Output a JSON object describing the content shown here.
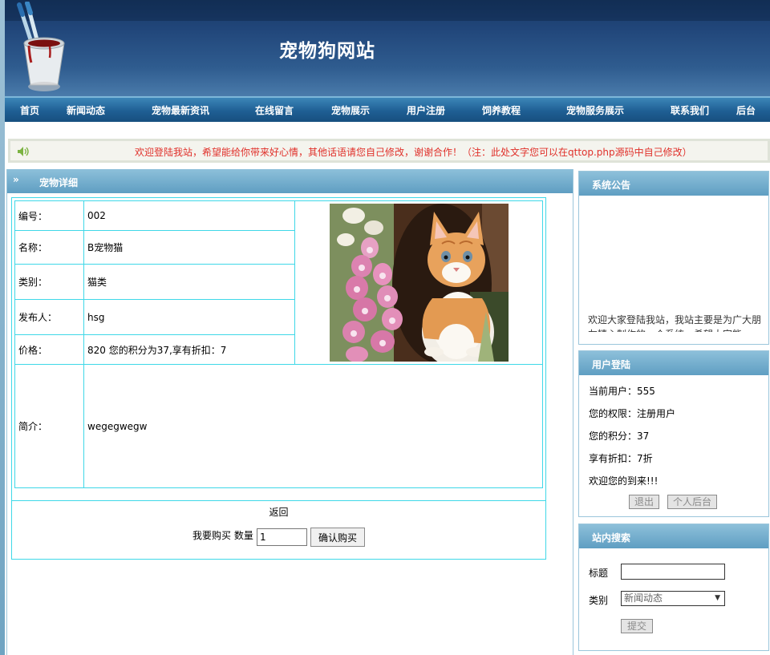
{
  "site": {
    "title": "宠物狗网站"
  },
  "nav": [
    "首页",
    "新闻动态",
    "宠物最新资讯",
    "在线留言",
    "宠物展示",
    "用户注册",
    "饲养教程",
    "宠物服务展示",
    "联系我们",
    "后台"
  ],
  "marquee": "欢迎登陆我站，希望能给你带来好心情，其他话语请您自己修改，谢谢合作！（注：此处文字您可以在qttop.php源码中自己修改）",
  "main": {
    "title": "宠物详细",
    "rows": [
      {
        "label": "编号：",
        "value": "002"
      },
      {
        "label": "名称：",
        "value": "B宠物猫"
      },
      {
        "label": "类别：",
        "value": "猫类"
      },
      {
        "label": "发布人：",
        "value": "hsg"
      },
      {
        "label": "价格：",
        "value": "820 您的积分为37,享有折扣：7"
      },
      {
        "label": "简介：",
        "value": "wegegwegw"
      }
    ],
    "back_label": "返回",
    "buy_label": "我要购买 数量",
    "quantity": "1",
    "buy_button": "确认购买"
  },
  "notice": {
    "title": "系统公告",
    "text": "欢迎大家登陆我站，我站主要是为广大朋友精心制作的一个系统，希望大家能"
  },
  "login": {
    "title": "用户登陆",
    "lines": [
      "当前用户：555",
      "您的权限：注册用户",
      "您的积分：37",
      "享有折扣：7折",
      "欢迎您的到来!!!"
    ],
    "logout": "退出",
    "backend": "个人后台"
  },
  "search": {
    "title": "站内搜索",
    "title_label": "标题",
    "category_label": "类别",
    "category_selected": "新闻动态",
    "submit": "提交"
  },
  "colors": {
    "header": "#21467a",
    "nav": "#1f5f94",
    "marquee_text": "#e0302a",
    "table_border": "#3fd8e8",
    "panel_head": "#6fa9c9"
  }
}
